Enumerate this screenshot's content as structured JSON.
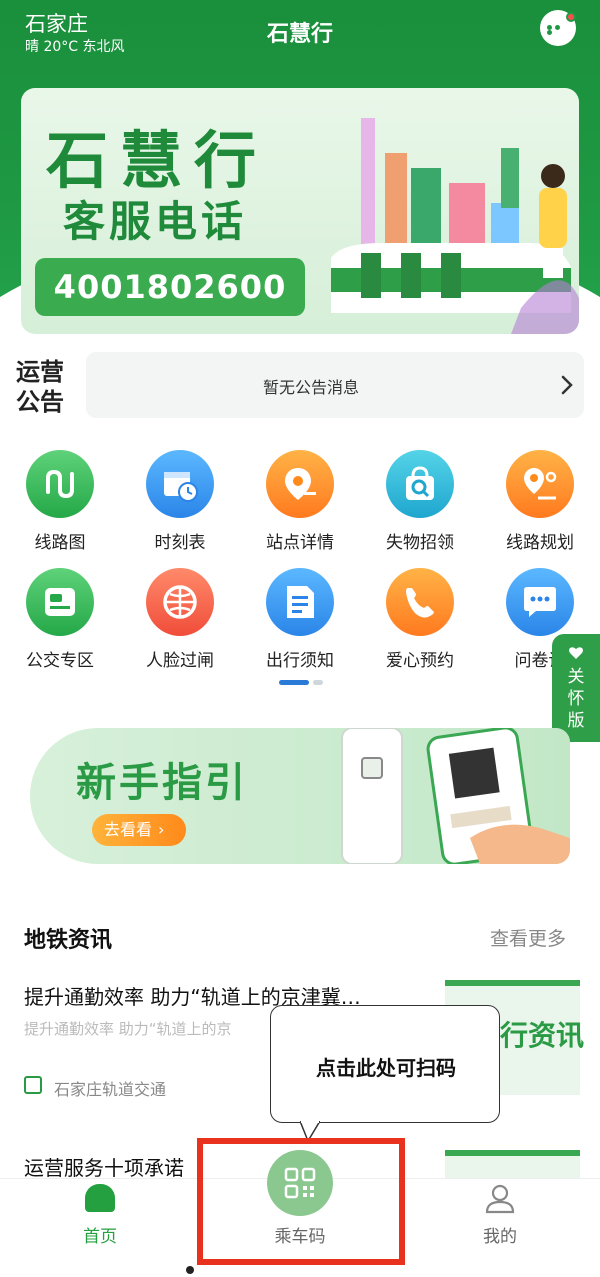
{
  "status": {
    "city": "石家庄",
    "weather": "晴 20°C 东北风"
  },
  "header": {
    "title": "石慧行"
  },
  "banner": {
    "title": "石慧行",
    "subtitle": "客服电话",
    "phone": "4001802600"
  },
  "notice": {
    "label": "运营公告",
    "text": "暂无公告消息"
  },
  "grid": {
    "items": [
      {
        "label": "线路图",
        "icon": "route-map-icon"
      },
      {
        "label": "时刻表",
        "icon": "timetable-icon"
      },
      {
        "label": "站点详情",
        "icon": "station-detail-icon"
      },
      {
        "label": "失物招领",
        "icon": "lost-found-icon"
      },
      {
        "label": "线路规划",
        "icon": "route-plan-icon"
      },
      {
        "label": "公交专区",
        "icon": "bus-zone-icon"
      },
      {
        "label": "人脸过闸",
        "icon": "face-gate-icon"
      },
      {
        "label": "出行须知",
        "icon": "travel-notice-icon"
      },
      {
        "label": "爱心预约",
        "icon": "care-booking-icon"
      },
      {
        "label": "问卷调",
        "icon": "survey-icon"
      }
    ]
  },
  "care_tab": {
    "label": "关怀版"
  },
  "guide": {
    "title": "新手指引",
    "button": "去看看"
  },
  "news": {
    "title": "地铁资讯",
    "more": "查看更多",
    "items": [
      {
        "title": "提升通勤效率 助力“轨道上的京津冀…",
        "subtitle": "提升通勤效率 助力“轨道上的京",
        "source": "石家庄轨道交通",
        "thumb_text": "行资讯"
      },
      {
        "title": "运营服务十项承诺"
      }
    ]
  },
  "tooltip": {
    "text": "点击此处可扫码"
  },
  "tabbar": {
    "home": "首页",
    "ride": "乘车码",
    "me": "我的"
  },
  "colors": {
    "brand_green": "#1f9943",
    "highlight_red": "#e8321e"
  }
}
